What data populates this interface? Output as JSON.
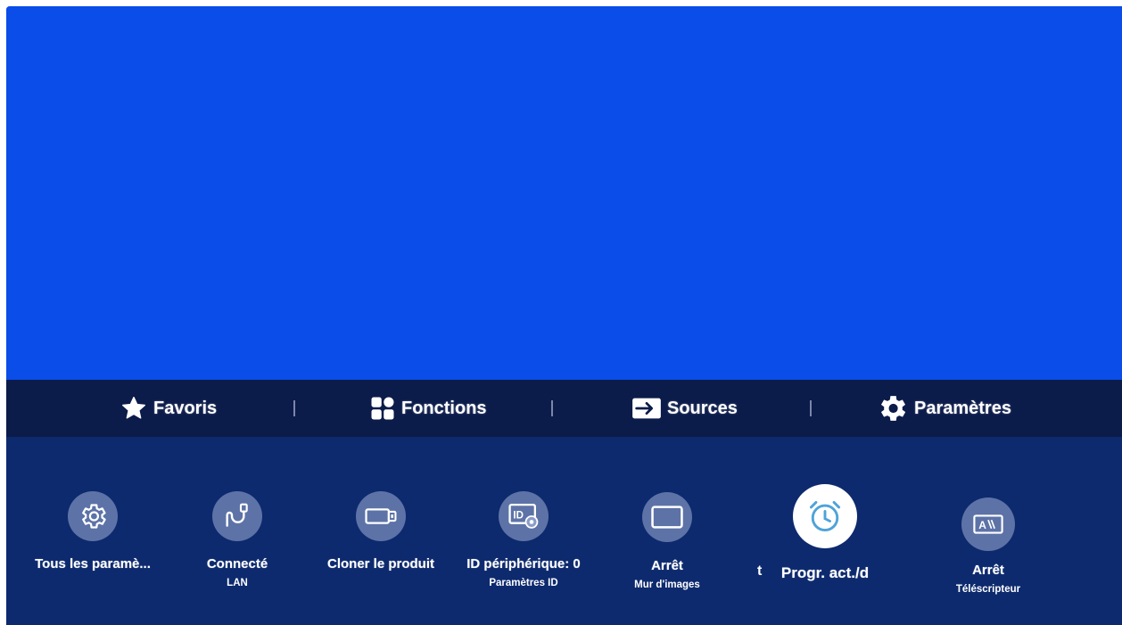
{
  "menu": {
    "items": [
      {
        "label": "Favoris",
        "icon": "star-icon"
      },
      {
        "label": "Fonctions",
        "icon": "apps-grid-icon"
      },
      {
        "label": "Sources",
        "icon": "source-input-icon"
      },
      {
        "label": "Paramètres",
        "icon": "gear-icon"
      }
    ]
  },
  "tiles": [
    {
      "label": "Tous les paramè...",
      "sub": "",
      "icon": "gear-icon"
    },
    {
      "label": "Connecté",
      "sub": "LAN",
      "icon": "lan-cable-icon"
    },
    {
      "label": "Cloner le produit",
      "sub": "",
      "icon": "usb-drive-icon"
    },
    {
      "label": "ID périphérique: 0",
      "sub": "Paramètres ID",
      "icon": "device-id-icon"
    },
    {
      "label": "Arrêt",
      "sub": "Mur d'images",
      "icon": "monitor-icon"
    },
    {
      "label": "Progr. act./d",
      "sub": "",
      "icon": "alarm-clock-icon",
      "focused": true
    },
    {
      "label": "Arrêt",
      "sub": "Téléscripteur",
      "icon": "ticker-icon"
    }
  ],
  "stray_glyph": "t",
  "colors": {
    "screen_blue": "#0a4de8",
    "menu_bar": "#0b1b4a",
    "panel": "#0d2a6e",
    "focus_icon": "#4fa3d8"
  }
}
